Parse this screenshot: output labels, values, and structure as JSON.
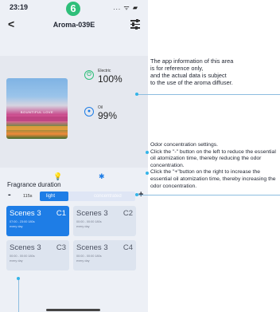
{
  "status": {
    "time": "23:19",
    "signal": "... ᯤ ▰"
  },
  "badge": "6",
  "nav": {
    "back": "<",
    "title": "Aroma-039E"
  },
  "metrics": {
    "electric": {
      "label": "Electric",
      "value": "100%",
      "icon": "power-icon"
    },
    "oil": {
      "label": "Oil",
      "value": "99%",
      "icon": "oil-drop-icon"
    }
  },
  "photo": {
    "caption": "BOUNTIFUL LOVE"
  },
  "icons": {
    "bulb": "light-bulb-icon",
    "bluetooth": "bluetooth-icon"
  },
  "fragrance": {
    "title": "Fragrance duration",
    "minus": "-",
    "plus": "+",
    "time": "115s",
    "level_label": "light",
    "max_label": "concentrated",
    "level_fraction": 0.3
  },
  "scenes": [
    {
      "name": "Scenes 3",
      "code": "C1",
      "detail": "07:00 - 23:00   180s",
      "days": "every day",
      "active": true
    },
    {
      "name": "Scenes 3",
      "code": "C2",
      "detail": "00:00 - 00:00   180s",
      "days": "every day",
      "active": false
    },
    {
      "name": "Scenes 3",
      "code": "C3",
      "detail": "00:00 - 00:00   180s",
      "days": "every day",
      "active": false
    },
    {
      "name": "Scenes 3",
      "code": "C4",
      "detail": "00:00 - 00:00   180s",
      "days": "every day",
      "active": false
    }
  ],
  "annotations": {
    "info": [
      "The app information of this area",
      "is for reference only,",
      "and the actual data is subject",
      "to the use of the aroma diffuser."
    ],
    "odor_title": "Odor concentration settings.",
    "odor_minus": "Click the \"-\" button on the left to reduce the essential oil atomization time, thereby reducing the odor concentration.",
    "odor_plus": "Click the \"+\"button on the right to increase the essential oil atomization time, thereby increasing the odor concentration."
  },
  "colors": {
    "accent": "#1e7de6",
    "badge": "#2fbf7a",
    "annotation": "#35b4e8"
  }
}
